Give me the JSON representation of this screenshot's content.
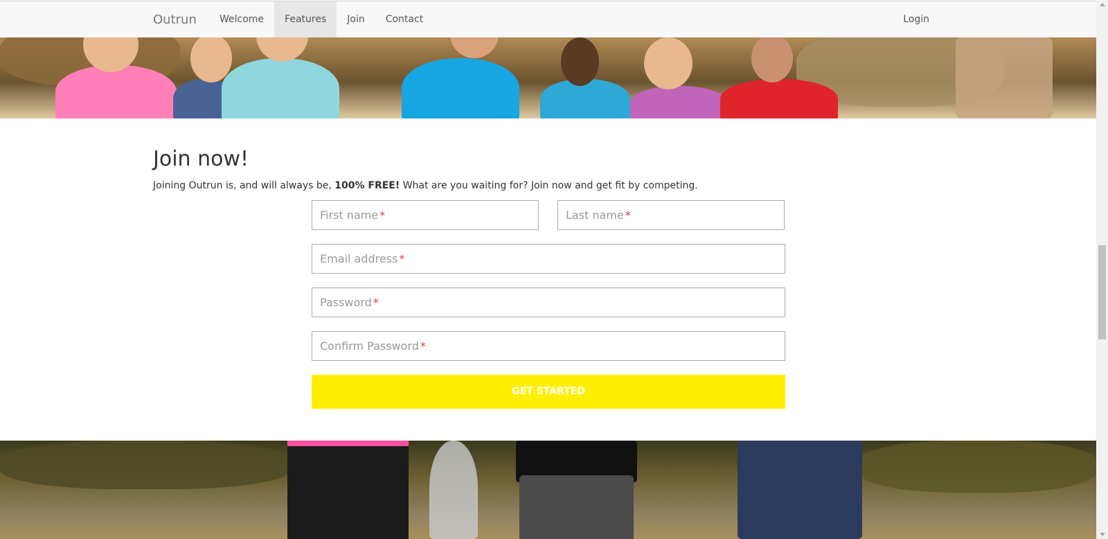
{
  "navbar": {
    "brand": "Outrun",
    "items": [
      {
        "label": "Welcome",
        "active": false
      },
      {
        "label": "Features",
        "active": true
      },
      {
        "label": "Join",
        "active": false
      },
      {
        "label": "Contact",
        "active": false
      }
    ],
    "login": "Login"
  },
  "join": {
    "title": "Join now!",
    "lead_before": "Joining Outrun is, and will always be, ",
    "lead_bold": "100% FREE!",
    "lead_after": " What are you waiting for? Join now and get fit by competing.",
    "required_marker": "*",
    "fields": {
      "first_name": "First name",
      "last_name": "Last name",
      "email": "Email address",
      "password": "Password",
      "confirm_password": "Confirm Password"
    },
    "submit": "GET STARTED"
  },
  "colors": {
    "button_bg": "#ffef00",
    "required": "#e43a3a"
  }
}
